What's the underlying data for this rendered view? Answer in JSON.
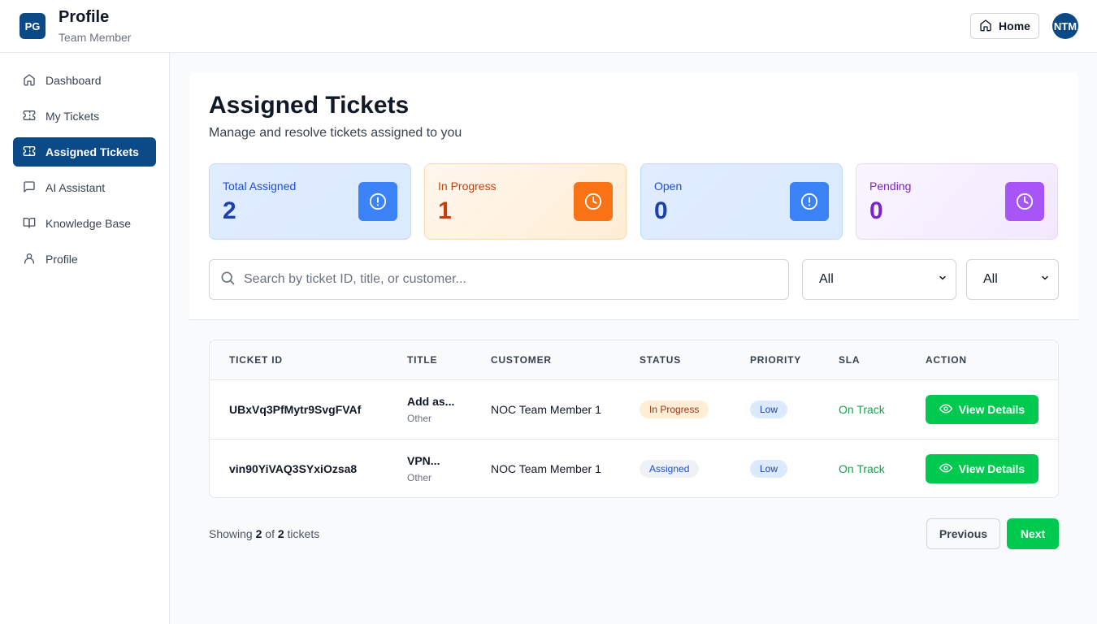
{
  "header": {
    "logo_text": "PG",
    "title": "Profile",
    "subtitle": "Team Member",
    "home_label": "Home",
    "avatar_text": "NTM"
  },
  "sidebar": {
    "items": [
      {
        "label": "Dashboard",
        "icon": "home-icon"
      },
      {
        "label": "My Tickets",
        "icon": "ticket-icon"
      },
      {
        "label": "Assigned Tickets",
        "icon": "ticket-icon",
        "active": true
      },
      {
        "label": "AI Assistant",
        "icon": "chat-icon"
      },
      {
        "label": "Knowledge Base",
        "icon": "book-icon"
      },
      {
        "label": "Profile",
        "icon": "user-icon"
      }
    ]
  },
  "main": {
    "title": "Assigned Tickets",
    "subtitle": "Manage and resolve tickets assigned to you",
    "stats": [
      {
        "label": "Total Assigned",
        "value": "2",
        "icon": "alert-circle-icon",
        "color": "#3b82f6"
      },
      {
        "label": "In Progress",
        "value": "1",
        "icon": "clock-icon",
        "color": "#f97316"
      },
      {
        "label": "Open",
        "value": "0",
        "icon": "alert-circle-icon",
        "color": "#3b82f6"
      },
      {
        "label": "Pending",
        "value": "0",
        "icon": "clock-icon",
        "color": "#a855f7"
      }
    ],
    "search_placeholder": "Search by ticket ID, title, or customer...",
    "filter_status": "All",
    "filter_priority": "All"
  },
  "table": {
    "headers": [
      "TICKET ID",
      "TITLE",
      "CUSTOMER",
      "STATUS",
      "PRIORITY",
      "SLA",
      "ACTION"
    ],
    "rows": [
      {
        "id": "UBxVq3PfMytr9SvgFVAf",
        "title": "Add as...",
        "category": "Other",
        "customer": "NOC Team Member 1",
        "status": "In Progress",
        "priority": "Low",
        "sla": "On Track",
        "action": "View Details"
      },
      {
        "id": "vin90YiVAQ3SYxiOzsa8",
        "title": "VPN...",
        "category": "Other",
        "customer": "NOC Team Member 1",
        "status": "Assigned",
        "priority": "Low",
        "sla": "On Track",
        "action": "View Details"
      }
    ]
  },
  "pagination": {
    "showing_prefix": "Showing",
    "shown": "2",
    "of": "of",
    "total": "2",
    "suffix": "tickets",
    "prev": "Previous",
    "next": "Next"
  },
  "colors": {
    "brand": "#0b4a86",
    "success": "#00c950"
  }
}
